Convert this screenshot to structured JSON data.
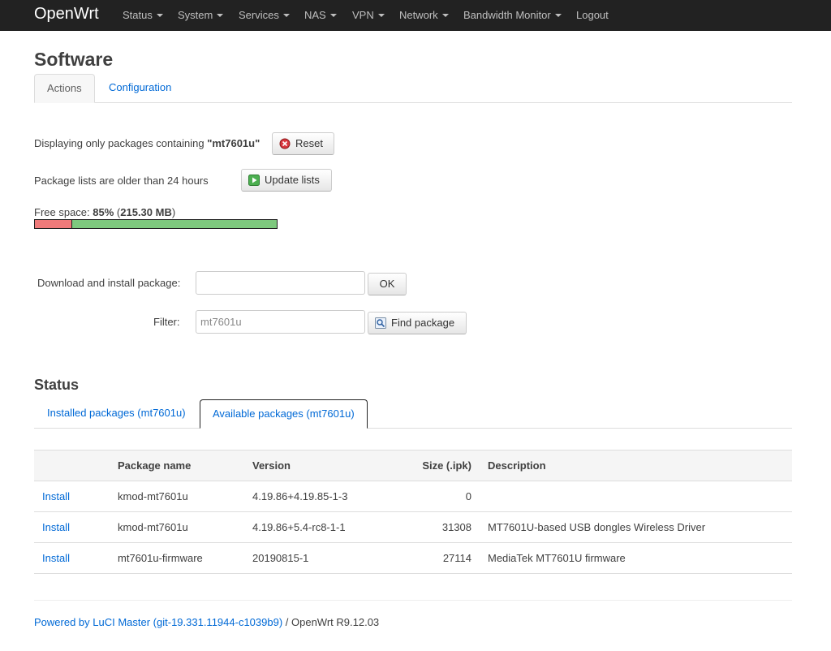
{
  "navbar": {
    "brand": "OpenWrt",
    "items": [
      {
        "label": "Status"
      },
      {
        "label": "System"
      },
      {
        "label": "Services"
      },
      {
        "label": "NAS"
      },
      {
        "label": "VPN"
      },
      {
        "label": "Network"
      },
      {
        "label": "Bandwidth Monitor"
      },
      {
        "label": "Logout"
      }
    ]
  },
  "page": {
    "title": "Software",
    "tabs": [
      {
        "label": "Actions",
        "active": true
      },
      {
        "label": "Configuration",
        "active": false
      }
    ]
  },
  "actions": {
    "filter_notice_prefix": "Displaying only packages containing ",
    "filter_notice_term": "\"mt7601u\"",
    "reset_label": "Reset",
    "lists_notice": "Package lists are older than 24 hours",
    "update_label": "Update lists",
    "free_space_prefix": "Free space: ",
    "free_space_percent": "85%",
    "free_space_size": "215.30 MB",
    "free_space_fraction": 0.85,
    "download_label": "Download and install package:",
    "download_value": "",
    "ok_label": "OK",
    "filter_label": "Filter:",
    "filter_value": "mt7601u",
    "find_label": "Find package"
  },
  "status": {
    "title": "Status",
    "tabs": [
      {
        "label": "Installed packages (mt7601u)",
        "active": false
      },
      {
        "label": "Available packages (mt7601u)",
        "active": true
      }
    ],
    "columns": [
      "",
      "Package name",
      "Version",
      "Size (.ipk)",
      "Description"
    ],
    "rows": [
      {
        "action": "Install",
        "name": "kmod-mt7601u",
        "version": "4.19.86+4.19.85-1-3",
        "size": "0",
        "description": ""
      },
      {
        "action": "Install",
        "name": "kmod-mt7601u",
        "version": "4.19.86+5.4-rc8-1-1",
        "size": "31308",
        "description": "MT7601U-based USB dongles Wireless Driver"
      },
      {
        "action": "Install",
        "name": "mt7601u-firmware",
        "version": "20190815-1",
        "size": "27114",
        "description": "MediaTek MT7601U firmware"
      }
    ]
  },
  "footer": {
    "link": "Powered by LuCI Master (git-19.331.11944-c1039b9)",
    "suffix": " / OpenWrt R9.12.03"
  },
  "colors": {
    "navbar_bg": "#222222",
    "link": "#0069d6",
    "used_space": "#ef7a7a",
    "free_space": "#7ec97e"
  }
}
